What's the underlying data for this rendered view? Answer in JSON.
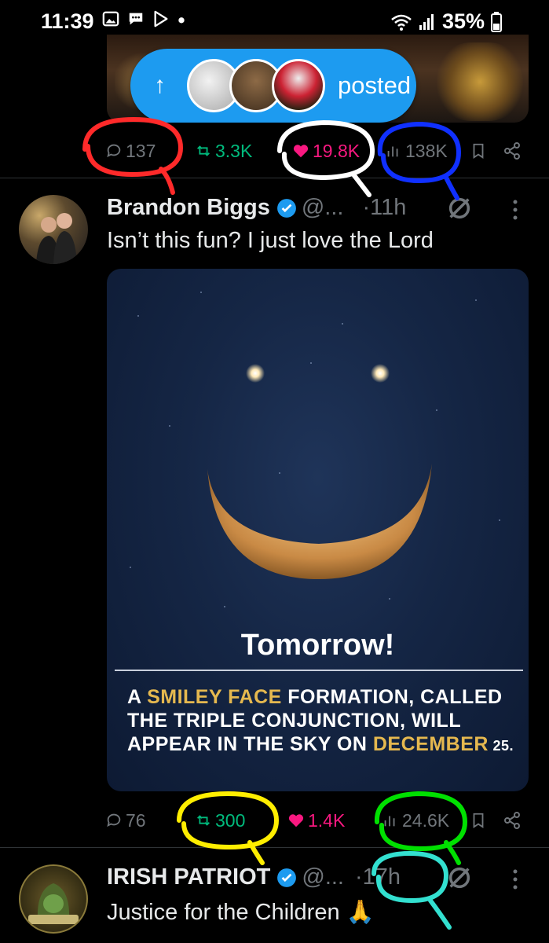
{
  "status_bar": {
    "time": "11:39",
    "battery": "35%",
    "icons": [
      "gallery-icon",
      "messages-icon",
      "play-store-icon",
      "dot-icon",
      "wifi-icon",
      "signal-icon",
      "battery-icon"
    ]
  },
  "new_posts_pill": {
    "label": "posted"
  },
  "top_tweet_actions": {
    "replies": "137",
    "reposts": "3.3K",
    "likes": "19.8K",
    "views": "138K"
  },
  "tweet1": {
    "name": "Brandon Biggs",
    "handle": "@...",
    "time": "·11h",
    "text": "Isn’t this fun? I just love the Lord",
    "media": {
      "title": "Tomorrow!",
      "caption_a": "A ",
      "caption_highlight1": "SMILEY FACE",
      "caption_b": " FORMATION, CALLED THE TRIPLE CONJUNCTION, WILL APPEAR IN THE SKY ON ",
      "caption_highlight2": "DECEMBER",
      "caption_c": " 25."
    },
    "actions": {
      "replies": "76",
      "reposts": "300",
      "likes": "1.4K",
      "views": "24.6K"
    }
  },
  "tweet2": {
    "name": "IRISH PATRIOT",
    "handle": "@...",
    "time": "·17h",
    "text": "Justice for the Children",
    "avatar_text": "IRISH PATRIOT"
  },
  "colors": {
    "accent": "#1d9bf0",
    "like": "#f91880",
    "repost": "#00ba7c",
    "muted": "#71767b"
  }
}
